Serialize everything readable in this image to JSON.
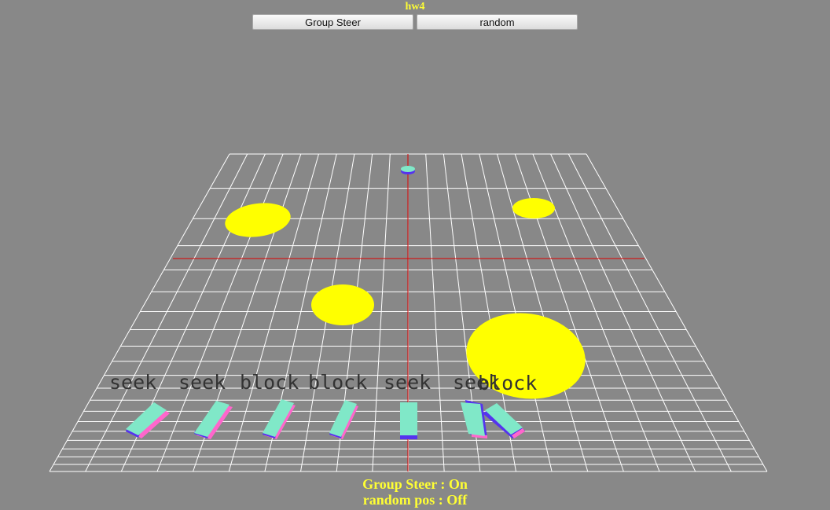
{
  "window": {
    "title": "hw4"
  },
  "toolbar": {
    "group_steer_label": "Group Steer",
    "random_label": "random"
  },
  "status": {
    "group_steer": "Group Steer : On",
    "random_pos": "random pos : Off"
  },
  "agents": [
    {
      "label": "seek"
    },
    {
      "label": "seek"
    },
    {
      "label": "block"
    },
    {
      "label": "block"
    },
    {
      "label": "seek"
    },
    {
      "label": "seek"
    },
    {
      "label": "block"
    }
  ],
  "colors": {
    "background": "#888888",
    "grid": "#ffffff",
    "axis": "#dd0000",
    "obstacle": "#ffff00",
    "agent_top": "#80e8c8",
    "agent_side_pink": "#ff66cc",
    "agent_side_blue": "#5533ee",
    "hud_text": "#ffff33"
  }
}
